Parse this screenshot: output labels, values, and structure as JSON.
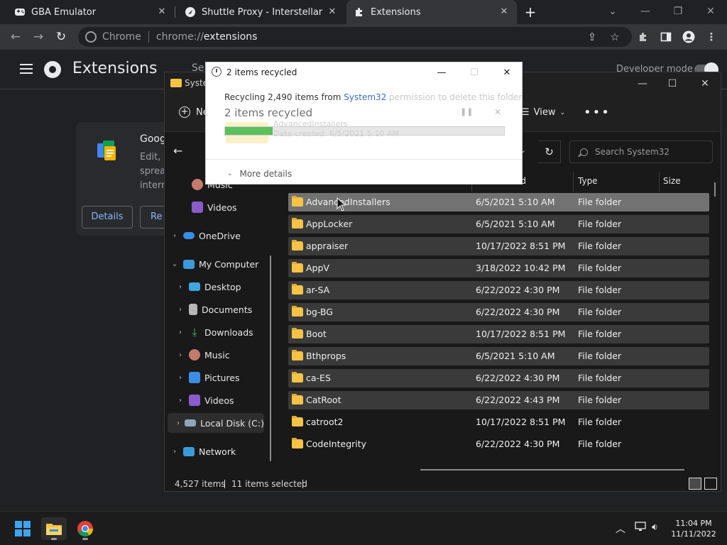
{
  "tabs": [
    {
      "title": "GBA Emulator",
      "active": false
    },
    {
      "title": "Shuttle Proxy - Interstellar Games",
      "active": false
    },
    {
      "title": "Extensions",
      "active": true
    }
  ],
  "omnibox": {
    "site": "Chrome",
    "url_scheme": "chrome://",
    "url_host": "extensions"
  },
  "ext_page": {
    "title": "Extensions",
    "search_placeholder": "Se",
    "dev_mode_label": "Developer mode",
    "card": {
      "name": "Googl",
      "desc_lines": [
        "Edit, c",
        "spread",
        "intern"
      ],
      "details_label": "Details",
      "remove_label": "Re"
    }
  },
  "explorer": {
    "title": "Syste",
    "cmd_new": "Ne",
    "cmd_view": "View",
    "search_placeholder": "Search System32",
    "nav_items": [
      {
        "label": "Music",
        "icon": "music-icon",
        "indent": 1,
        "expandable": false
      },
      {
        "label": "Videos",
        "icon": "videos-icon",
        "indent": 1,
        "expandable": false
      },
      {
        "label": "OneDrive",
        "icon": "onedrive-icon",
        "indent": 0,
        "expandable": true
      },
      {
        "label": "My Computer",
        "icon": "computer-icon",
        "indent": 0,
        "expandable": true,
        "expanded": true
      },
      {
        "label": "Desktop",
        "icon": "desktop-icon",
        "indent": 1,
        "expandable": true
      },
      {
        "label": "Documents",
        "icon": "documents-icon",
        "indent": 1,
        "expandable": true
      },
      {
        "label": "Downloads",
        "icon": "downloads-icon",
        "indent": 1,
        "expandable": true
      },
      {
        "label": "Music",
        "icon": "music-icon",
        "indent": 1,
        "expandable": true
      },
      {
        "label": "Pictures",
        "icon": "pictures-icon",
        "indent": 1,
        "expandable": true
      },
      {
        "label": "Videos",
        "icon": "videos-icon",
        "indent": 1,
        "expandable": true
      },
      {
        "label": "Local Disk (C:)",
        "icon": "local-disk-icon",
        "indent": 1,
        "expandable": true,
        "selected": true
      },
      {
        "label": "Network",
        "icon": "network-icon",
        "indent": 0,
        "expandable": true
      }
    ],
    "columns": {
      "name": "",
      "date": "ed",
      "type": "Type",
      "size": "Size"
    },
    "files": [
      {
        "name": "AdvancedInstallers",
        "date": "6/5/2021 5:10 AM",
        "type": "File folder",
        "highlight": true
      },
      {
        "name": "AppLocker",
        "date": "6/5/2021 5:10 AM",
        "type": "File folder"
      },
      {
        "name": "appraiser",
        "date": "10/17/2022 8:51 PM",
        "type": "File folder"
      },
      {
        "name": "AppV",
        "date": "3/18/2022 10:42 PM",
        "type": "File folder"
      },
      {
        "name": "ar-SA",
        "date": "6/22/2022 4:30 PM",
        "type": "File folder"
      },
      {
        "name": "bg-BG",
        "date": "6/22/2022 4:30 PM",
        "type": "File folder"
      },
      {
        "name": "Boot",
        "date": "10/17/2022 8:51 PM",
        "type": "File folder"
      },
      {
        "name": "Bthprops",
        "date": "6/5/2021 5:10 AM",
        "type": "File folder"
      },
      {
        "name": "ca-ES",
        "date": "6/22/2022 4:30 PM",
        "type": "File folder"
      },
      {
        "name": "CatRoot",
        "date": "6/22/2022 4:43 PM",
        "type": "File folder"
      },
      {
        "name": "catroot2",
        "date": "10/17/2022 8:51 PM",
        "type": "File folder"
      },
      {
        "name": "CodeIntegrity",
        "date": "6/22/2022 4:30 PM",
        "type": "File folder"
      }
    ],
    "status": {
      "item_count": "4,527 items",
      "selected": "11 items selected"
    }
  },
  "dialog": {
    "title": "2 items recycled",
    "line1_prefix": "Recycling 2,490 items from ",
    "line1_source": "System32",
    "ghost_text": "permission to delete this folder",
    "big_text": "2 items recycled",
    "ghost_name": "AdvancedInstallers",
    "ghost_date": "Date created: 6/5/2021 5:10 AM",
    "progress": 0.17,
    "more_details": "More details"
  },
  "taskbar": {
    "time": "11:04 PM",
    "date": "11/11/2022"
  },
  "colors": {
    "accent_blue": "#8ab4f8",
    "folder_yellow": "#f6c344",
    "progress_green": "#5cbf5c"
  }
}
